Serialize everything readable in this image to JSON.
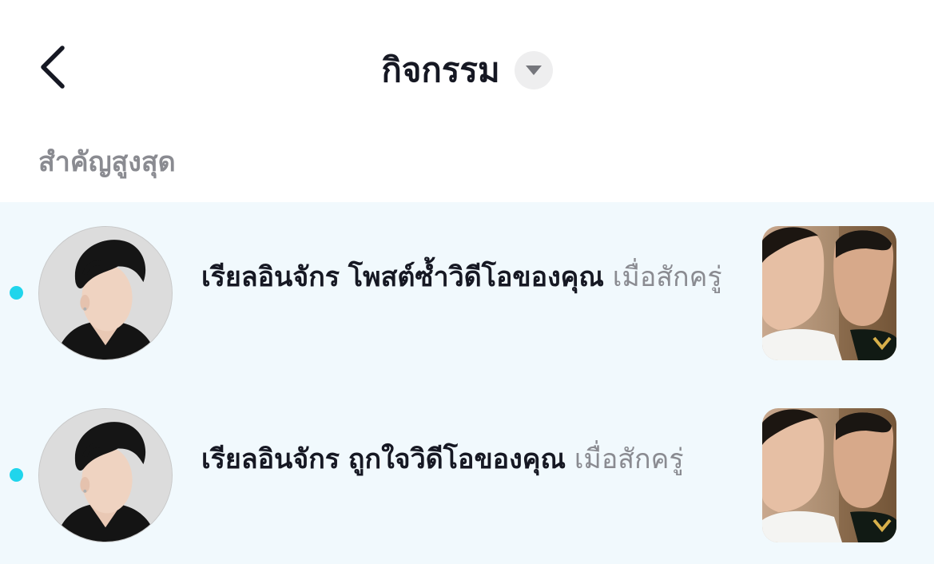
{
  "header": {
    "title": "กิจกรรม",
    "back_icon": "chevron-left-icon",
    "dropdown_icon": "caret-down-icon"
  },
  "section": {
    "label": "สำคัญสูงสุด"
  },
  "colors": {
    "unread_dot": "#20d5ec",
    "list_bg": "#f1f9fd",
    "muted_text": "#8a8b91"
  },
  "notifications": [
    {
      "username": "เรียลอินจักร",
      "action": "โพสต์ซ้ำวิดีโอของคุณ",
      "time": "เมื่อสักครู่",
      "unread": true
    },
    {
      "username": "เรียลอินจักร",
      "action": "ถูกใจวิดีโอของคุณ",
      "time": "เมื่อสักครู่",
      "unread": true
    }
  ]
}
